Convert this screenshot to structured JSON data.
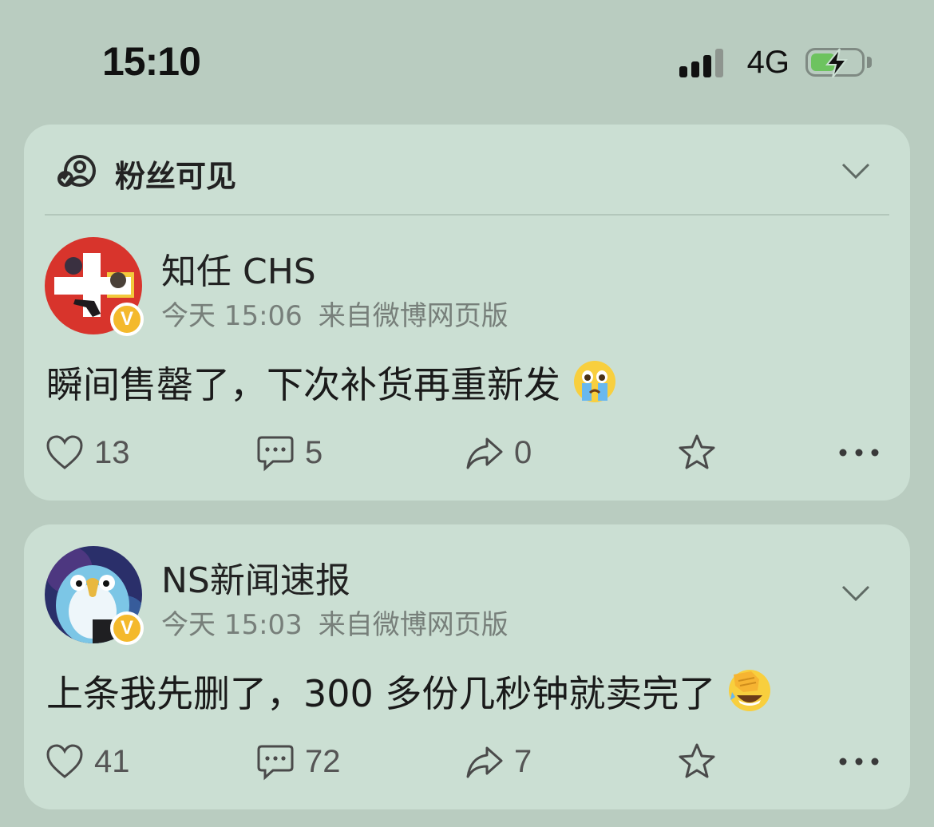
{
  "status_bar": {
    "time": "15:10",
    "network": "4G",
    "battery_level": 0.5
  },
  "posts": [
    {
      "visibility": "粉丝可见",
      "username": "知任 CHS",
      "verified": true,
      "time": "今天 15:06",
      "source": "来自微博网页版",
      "text": "瞬间售罄了，下次补货再重新发",
      "emoji_icon": "crying-face-icon",
      "likes": "13",
      "comments": "5",
      "reposts": "0"
    },
    {
      "username": "NS新闻速报",
      "verified": true,
      "time": "今天 15:03",
      "source": "来自微博网页版",
      "text": "上条我先删了，300 多份几秒钟就卖完了",
      "emoji_icon": "facepalm-laughing-icon",
      "likes": "41",
      "comments": "72",
      "reposts": "7"
    }
  ],
  "colors": {
    "background": "#b9ccc0",
    "card": "#cbdfd3",
    "badge": "#f4b92c"
  }
}
